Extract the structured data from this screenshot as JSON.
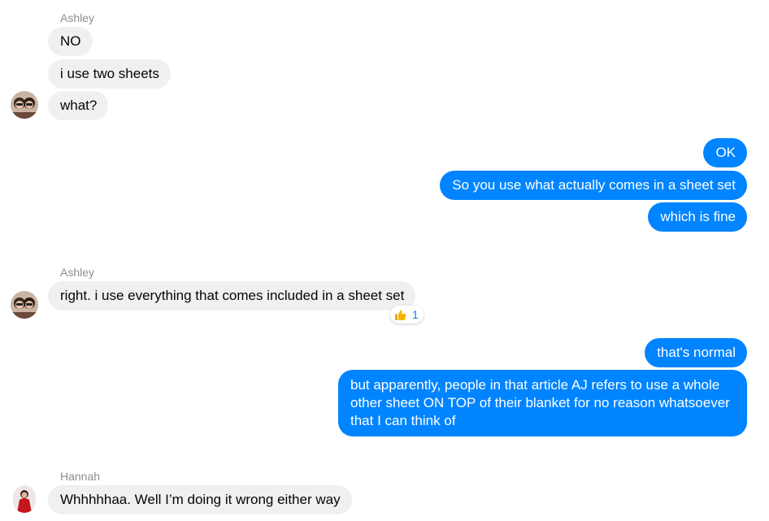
{
  "messages": {
    "ashley_name_1": "Ashley",
    "m1": "NO",
    "m2": "i use two sheets",
    "m3": "what?",
    "m4": "OK",
    "m5": "So you use what actually comes in a sheet set",
    "m6": "which is fine",
    "ashley_name_2": "Ashley",
    "m7": "right. i use everything that comes included in a sheet set",
    "m7_reaction_count": "1",
    "m8": "that's normal",
    "m9": "but apparently, people in that article AJ refers to use a whole other sheet ON TOP of their blanket for no reason whatsoever that I can think of",
    "hannah_name": "Hannah",
    "m10": "Whhhhhaa. Well I’m doing it wrong either way"
  },
  "colors": {
    "outgoing_bubble": "#0084ff",
    "incoming_bubble": "#f0f0f0",
    "sender_name": "#8a8d91"
  },
  "icons": {
    "reaction": "thumbs-up-icon",
    "avatar_ashley": "avatar-ashley",
    "avatar_hannah": "avatar-hannah"
  }
}
